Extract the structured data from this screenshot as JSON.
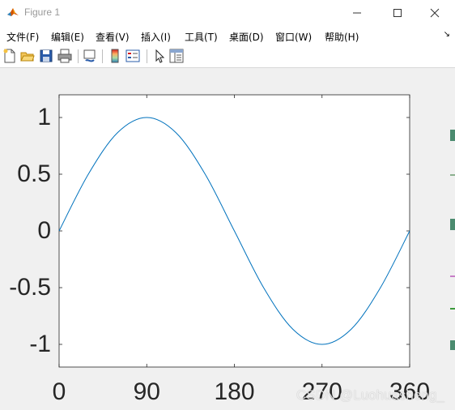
{
  "window": {
    "title": "Figure 1",
    "controls": [
      "minimize-icon",
      "maximize-icon",
      "close-icon"
    ]
  },
  "menu": {
    "items": [
      "文件(F)",
      "编辑(E)",
      "查看(V)",
      "插入(I)",
      "工具(T)",
      "桌面(D)",
      "窗口(W)",
      "帮助(H)"
    ],
    "dock_glyph": "↘"
  },
  "toolbar": {
    "buttons": [
      "new-figure-icon",
      "open-file-icon",
      "save-icon",
      "print-icon",
      "link-plot-icon",
      "colorbar-icon",
      "legend-icon",
      "edit-plot-arrow-icon",
      "property-editor-icon"
    ]
  },
  "chart_data": {
    "type": "line",
    "title": "",
    "xlabel": "",
    "ylabel": "",
    "xlim": [
      0,
      360
    ],
    "ylim": [
      -1.2,
      1.2
    ],
    "xticks": [
      0,
      90,
      180,
      270,
      360
    ],
    "xtick_labels": [
      "0",
      "90",
      "180",
      "270",
      "360"
    ],
    "yticks": [
      1,
      0.5,
      0,
      -0.5,
      -1
    ],
    "ytick_labels": [
      "1",
      "0.5",
      "0",
      "-0.5",
      "-1"
    ],
    "grid": false,
    "series": [
      {
        "color": "#0072bd",
        "x": [
          0,
          30,
          60,
          90,
          120,
          150,
          180,
          210,
          240,
          270,
          300,
          330,
          360
        ],
        "y": [
          0,
          0.5,
          0.866,
          1,
          0.866,
          0.5,
          0,
          -0.5,
          -0.866,
          -1,
          -0.866,
          -0.5,
          0
        ]
      }
    ]
  },
  "watermark": "CSDN @Luohuasheng_",
  "colors": {
    "line": "#0072bd",
    "axes_bg": "#ffffff",
    "figure_bg": "#f0f0f0"
  }
}
